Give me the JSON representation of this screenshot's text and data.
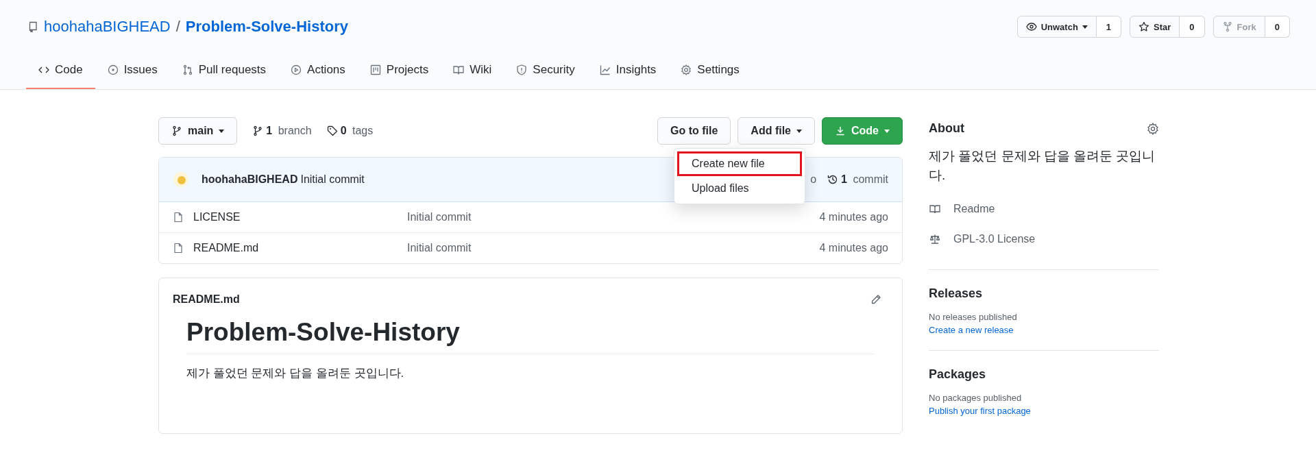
{
  "repo": {
    "owner": "hoohahaBIGHEAD",
    "separator": "/",
    "name": "Problem-Solve-History"
  },
  "repo_actions": [
    {
      "label": "Unwatch",
      "count": "1",
      "kind": "watch",
      "disabled": false
    },
    {
      "label": "Star",
      "count": "0",
      "kind": "star",
      "disabled": false
    },
    {
      "label": "Fork",
      "count": "0",
      "kind": "fork",
      "disabled": true
    }
  ],
  "tabs": [
    {
      "label": "Code",
      "kind": "code",
      "selected": true
    },
    {
      "label": "Issues",
      "kind": "issue",
      "selected": false
    },
    {
      "label": "Pull requests",
      "kind": "pr",
      "selected": false
    },
    {
      "label": "Actions",
      "kind": "play",
      "selected": false
    },
    {
      "label": "Projects",
      "kind": "project",
      "selected": false
    },
    {
      "label": "Wiki",
      "kind": "book",
      "selected": false
    },
    {
      "label": "Security",
      "kind": "shield",
      "selected": false
    },
    {
      "label": "Insights",
      "kind": "graph",
      "selected": false
    },
    {
      "label": "Settings",
      "kind": "gear",
      "selected": false
    }
  ],
  "branch_bar": {
    "branch": "main",
    "branch_count": "1",
    "branch_label": "branch",
    "tag_count": "0",
    "tag_label": "tags",
    "go_to_file": "Go to file",
    "add_file": "Add file",
    "code": "Code"
  },
  "add_file_menu": [
    {
      "label": "Create new file",
      "highlighted": true
    },
    {
      "label": "Upload files",
      "highlighted": false
    }
  ],
  "latest_commit": {
    "author": "hoohahaBIGHEAD",
    "message": "Initial commit",
    "time_fragment": "o",
    "commit_count": "1",
    "commit_label": "commit"
  },
  "files": [
    {
      "name": "LICENSE",
      "message": "Initial commit",
      "time": "4 minutes ago"
    },
    {
      "name": "README.md",
      "message": "Initial commit",
      "time": "4 minutes ago"
    }
  ],
  "readme": {
    "filename": "README.md",
    "heading": "Problem-Solve-History",
    "body": "제가 풀었던 문제와 답을 올려둔 곳입니다."
  },
  "about": {
    "title": "About",
    "description": "제가 풀었던 문제와 답을 올려둔 곳입니다.",
    "links": [
      {
        "label": "Readme",
        "kind": "book"
      },
      {
        "label": "GPL-3.0 License",
        "kind": "scale"
      }
    ]
  },
  "releases": {
    "title": "Releases",
    "note": "No releases published",
    "link": "Create a new release"
  },
  "packages": {
    "title": "Packages",
    "note": "No packages published",
    "link": "Publish your first package"
  }
}
